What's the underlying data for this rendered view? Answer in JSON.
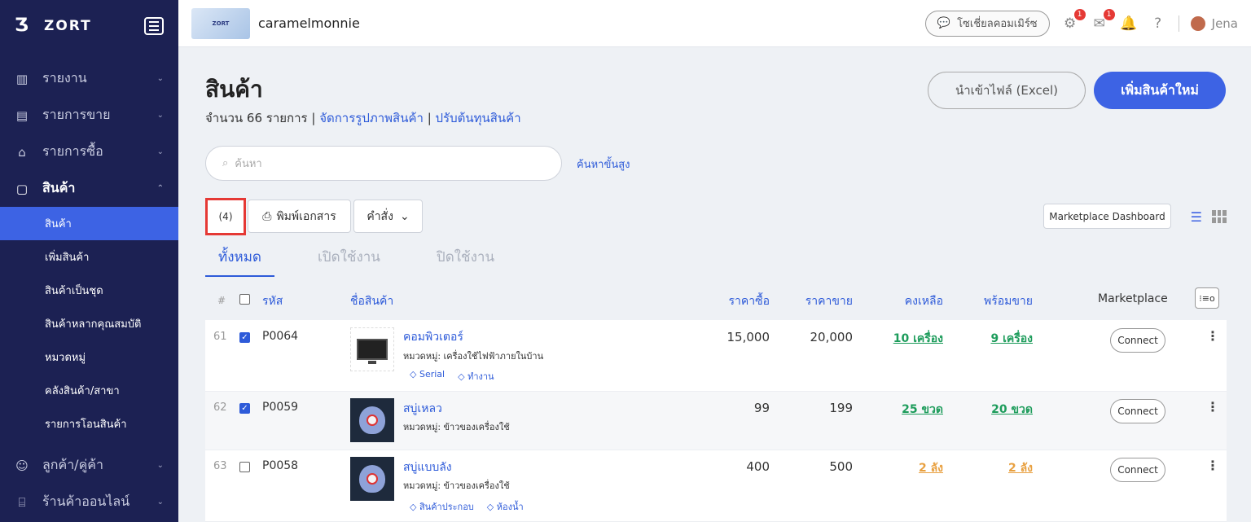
{
  "sidebar": {
    "logo_text": "ZORT",
    "items": [
      {
        "label": "รายงาน",
        "icon": "chart-icon"
      },
      {
        "label": "รายการขาย",
        "icon": "clipboard-icon"
      },
      {
        "label": "รายการซื้อ",
        "icon": "basket-icon"
      },
      {
        "label": "สินค้า",
        "icon": "box-icon"
      }
    ],
    "sub_items": [
      "สินค้า",
      "เพิ่มสินค้า",
      "สินค้าเป็นชุด",
      "สินค้าหลากคุณสมบัติ",
      "หมวดหมู่",
      "คลังสินค้า/สาขา",
      "รายการโอนสินค้า"
    ],
    "bottom_items": [
      {
        "label": "ลูกค้า/คู่ค้า",
        "icon": "users-icon"
      },
      {
        "label": "ร้านค้าออนไลน์",
        "icon": "store-icon"
      }
    ]
  },
  "topbar": {
    "shop_logo_text": "ZORT",
    "shop_name": "caramelmonnie",
    "chat_label": "โซเชี่ยลคอมเมิร์ซ",
    "badge_1": "1",
    "badge_2": "1",
    "user_name": "Jena"
  },
  "page": {
    "title": "สินค้า",
    "count_text": "จำนวน 66 รายการ | ",
    "link_images": "จัดการรูปภาพสินค้า",
    "sep": " | ",
    "link_cost": "ปรับต้นทุนสินค้า",
    "import_label": "นำเข้าไฟล์ (Excel)",
    "add_label": "เพิ่มสินค้าใหม่",
    "search_placeholder": "ค้นหา",
    "adv_search": "ค้นหาขั้นสูง",
    "selected_count": "(4)",
    "print_label": "พิมพ์เอกสาร",
    "command_label": "คำสั่ง",
    "marketplace_dashboard": "Marketplace Dashboard"
  },
  "tabs": [
    "ทั้งหมด",
    "เปิดใช้งาน",
    "ปิดใช้งาน"
  ],
  "table": {
    "headers": {
      "hash": "#",
      "code": "รหัส",
      "name": "ชื่อสินค้า",
      "buy": "ราคาซื้อ",
      "sell": "ราคาขาย",
      "remaining": "คงเหลือ",
      "ready": "พร้อมขาย",
      "marketplace": "Marketplace",
      "settings": "⁝≡o"
    },
    "rows": [
      {
        "num": "61",
        "checked": true,
        "code": "P0064",
        "name": "คอมพิวเตอร์",
        "category": "หมวดหมู่: เครื่องใช้ไฟฟ้าภายในบ้าน",
        "tags": [
          "Serial",
          "ทำงาน"
        ],
        "buy": "15,000",
        "sell": "20,000",
        "remaining": "10 เครื่อง",
        "ready": "9 เครื่อง",
        "connect": "Connect"
      },
      {
        "num": "62",
        "checked": true,
        "code": "P0059",
        "name": "สบู่เหลว",
        "category": "หมวดหมู่: ข้าวของเครื่องใช้",
        "tags": [],
        "buy": "99",
        "sell": "199",
        "remaining": "25 ขวด",
        "ready": "20 ขวด",
        "connect": "Connect"
      },
      {
        "num": "63",
        "checked": false,
        "code": "P0058",
        "name": "สบู่แบบลัง",
        "category": "หมวดหมู่: ข้าวของเครื่องใช้",
        "tags": [
          "สินค้าประกอบ",
          "ห้องน้ำ"
        ],
        "buy": "400",
        "sell": "500",
        "remaining": "2 ลัง",
        "ready": "2 ลัง",
        "connect": "Connect"
      }
    ]
  },
  "colors": {
    "sidebar_bg": "#1c2153",
    "accent": "#3d63e4",
    "stock_green": "#1d9c5b",
    "stock_orange": "#e8a040",
    "highlight_red": "#e53935"
  }
}
